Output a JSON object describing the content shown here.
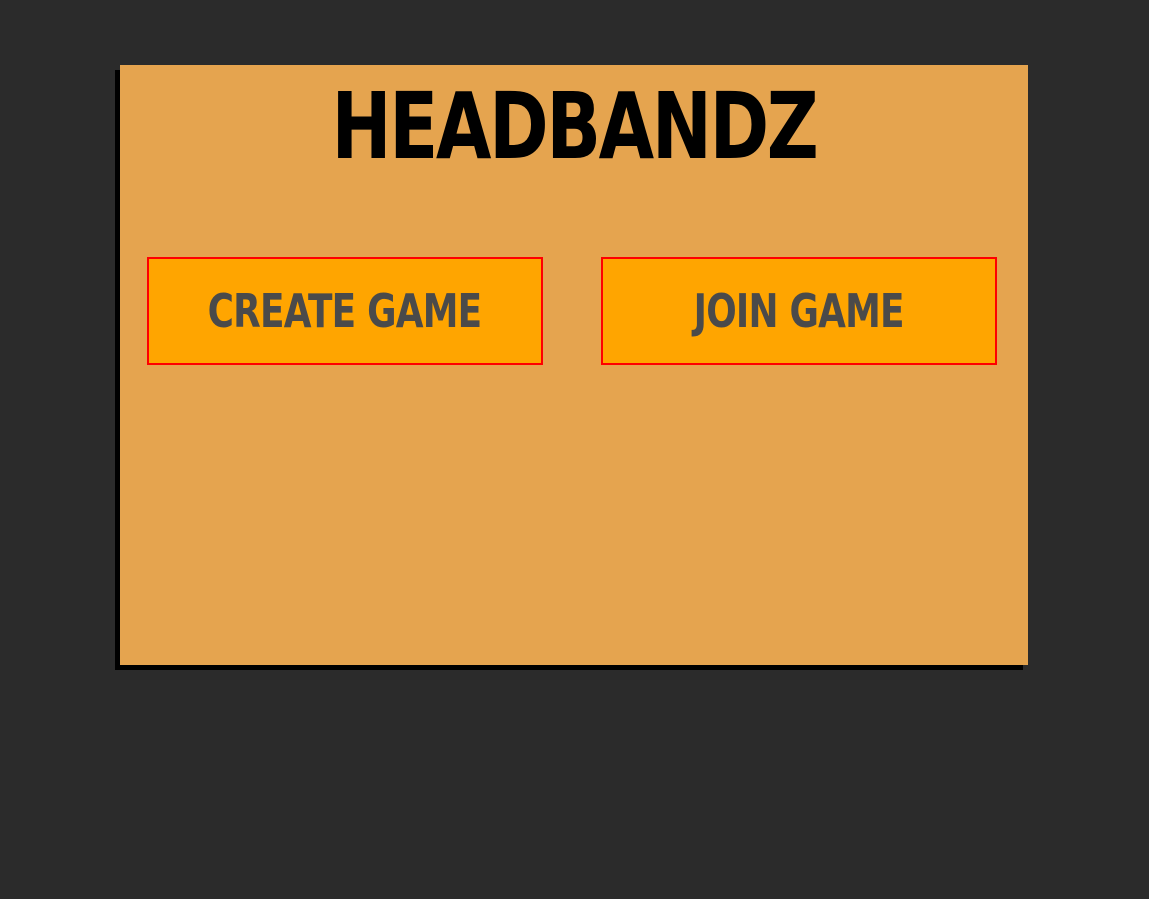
{
  "game": {
    "title": "HEADBANDZ"
  },
  "menu": {
    "create_label": "CREATE GAME",
    "join_label": "JOIN GAME"
  },
  "colors": {
    "background": "#2b2b2b",
    "panel": "#e5a44f",
    "button": "#ffa500",
    "button_border": "#ff0000",
    "button_text": "#4a4a4a",
    "title": "#000000"
  }
}
